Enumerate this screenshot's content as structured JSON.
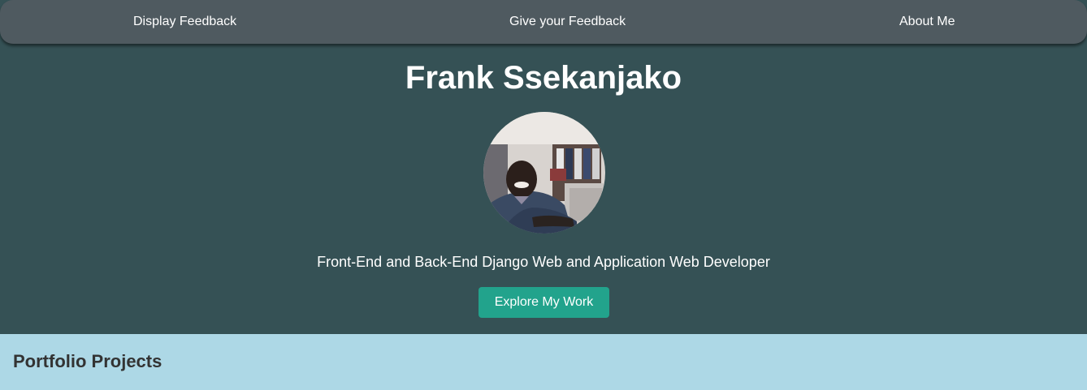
{
  "nav": {
    "items": [
      {
        "label": "Display Feedback"
      },
      {
        "label": "Give your Feedback"
      },
      {
        "label": "About Me"
      }
    ]
  },
  "hero": {
    "name": "Frank Ssekanjako",
    "tagline": "Front-End and Back-End Django Web and Application Web Developer",
    "cta_label": "Explore My Work"
  },
  "portfolio": {
    "title": "Portfolio Projects"
  },
  "colors": {
    "navbar": "#4f5a60",
    "hero_background": "#355155",
    "cta_background": "#22a38c",
    "portfolio_background": "#add8e6",
    "portfolio_title": "#333333"
  }
}
